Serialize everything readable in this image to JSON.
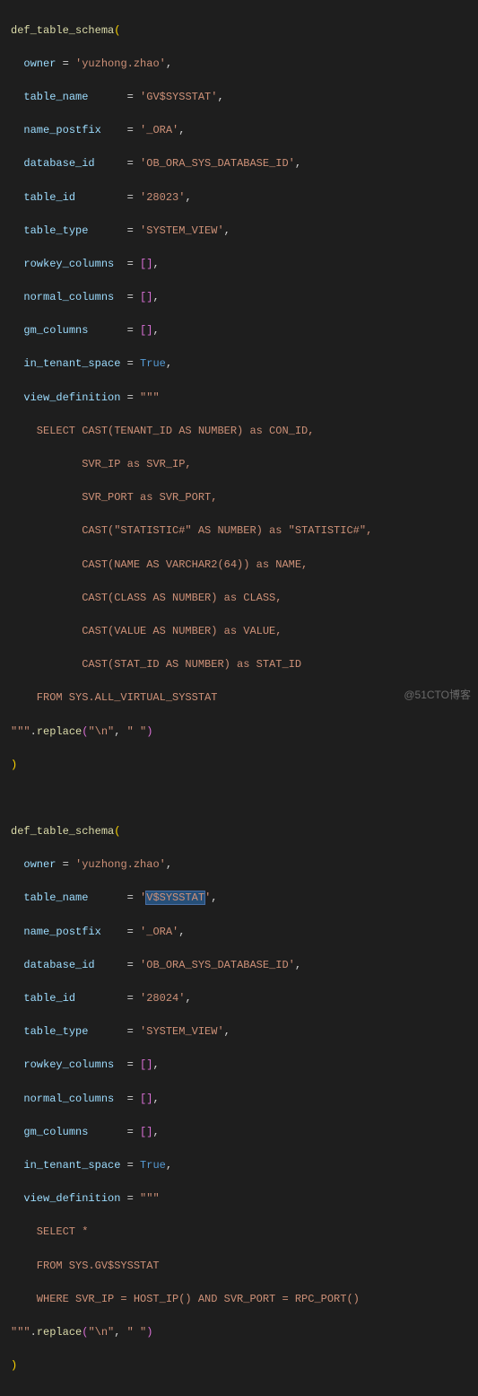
{
  "block1": {
    "fn": "def_table_schema",
    "owner_key": "owner",
    "owner_val": "'yuzhong.zhao'",
    "table_name_key": "table_name",
    "table_name_val": "'GV$SYSSTAT'",
    "name_postfix_key": "name_postfix",
    "name_postfix_val": "'_ORA'",
    "database_id_key": "database_id",
    "database_id_val": "'OB_ORA_SYS_DATABASE_ID'",
    "table_id_key": "table_id",
    "table_id_val": "'28023'",
    "table_type_key": "table_type",
    "table_type_val": "'SYSTEM_VIEW'",
    "rowkey_columns_key": "rowkey_columns",
    "normal_columns_key": "normal_columns",
    "gm_columns_key": "gm_columns",
    "empty_list": "[]",
    "in_tenant_space_key": "in_tenant_space",
    "in_tenant_space_val": "True",
    "view_definition_key": "view_definition",
    "triple_quote": "\"\"\"",
    "sql_l1": "    SELECT CAST(TENANT_ID AS NUMBER) as CON_ID,",
    "sql_l2": "           SVR_IP as SVR_IP,",
    "sql_l3": "           SVR_PORT as SVR_PORT,",
    "sql_l4": "           CAST(\"STATISTIC#\" AS NUMBER) as \"STATISTIC#\",",
    "sql_l5": "           CAST(NAME AS VARCHAR2(64)) as NAME,",
    "sql_l6": "           CAST(CLASS AS NUMBER) as CLASS,",
    "sql_l7": "           CAST(VALUE AS NUMBER) as VALUE,",
    "sql_l8": "           CAST(STAT_ID AS NUMBER) as STAT_ID",
    "sql_l9": "    FROM SYS.ALL_VIRTUAL_SYSSTAT",
    "replace_fn": "replace",
    "replace_a1": "\"\\n\"",
    "replace_a2": "\" \""
  },
  "block2": {
    "fn": "def_table_schema",
    "owner_key": "owner",
    "owner_val": "'yuzhong.zhao'",
    "table_name_key": "table_name",
    "table_name_pre": "'",
    "table_name_hl": "V$SYSSTAT",
    "table_name_post": "'",
    "name_postfix_key": "name_postfix",
    "name_postfix_val": "'_ORA'",
    "database_id_key": "database_id",
    "database_id_val": "'OB_ORA_SYS_DATABASE_ID'",
    "table_id_key": "table_id",
    "table_id_val": "'28024'",
    "table_type_key": "table_type",
    "table_type_val": "'SYSTEM_VIEW'",
    "rowkey_columns_key": "rowkey_columns",
    "normal_columns_key": "normal_columns",
    "gm_columns_key": "gm_columns",
    "empty_list": "[]",
    "in_tenant_space_key": "in_tenant_space",
    "in_tenant_space_val": "True",
    "view_definition_key": "view_definition",
    "triple_quote": "\"\"\"",
    "sql_l1": "    SELECT *",
    "sql_l2": "    FROM SYS.GV$SYSSTAT",
    "sql_l3": "    WHERE SVR_IP = HOST_IP() AND SVR_PORT = RPC_PORT()",
    "replace_fn": "replace",
    "replace_a1": "\"\\n\"",
    "replace_a2": "\" \""
  },
  "watermark": "@51CTO博客"
}
